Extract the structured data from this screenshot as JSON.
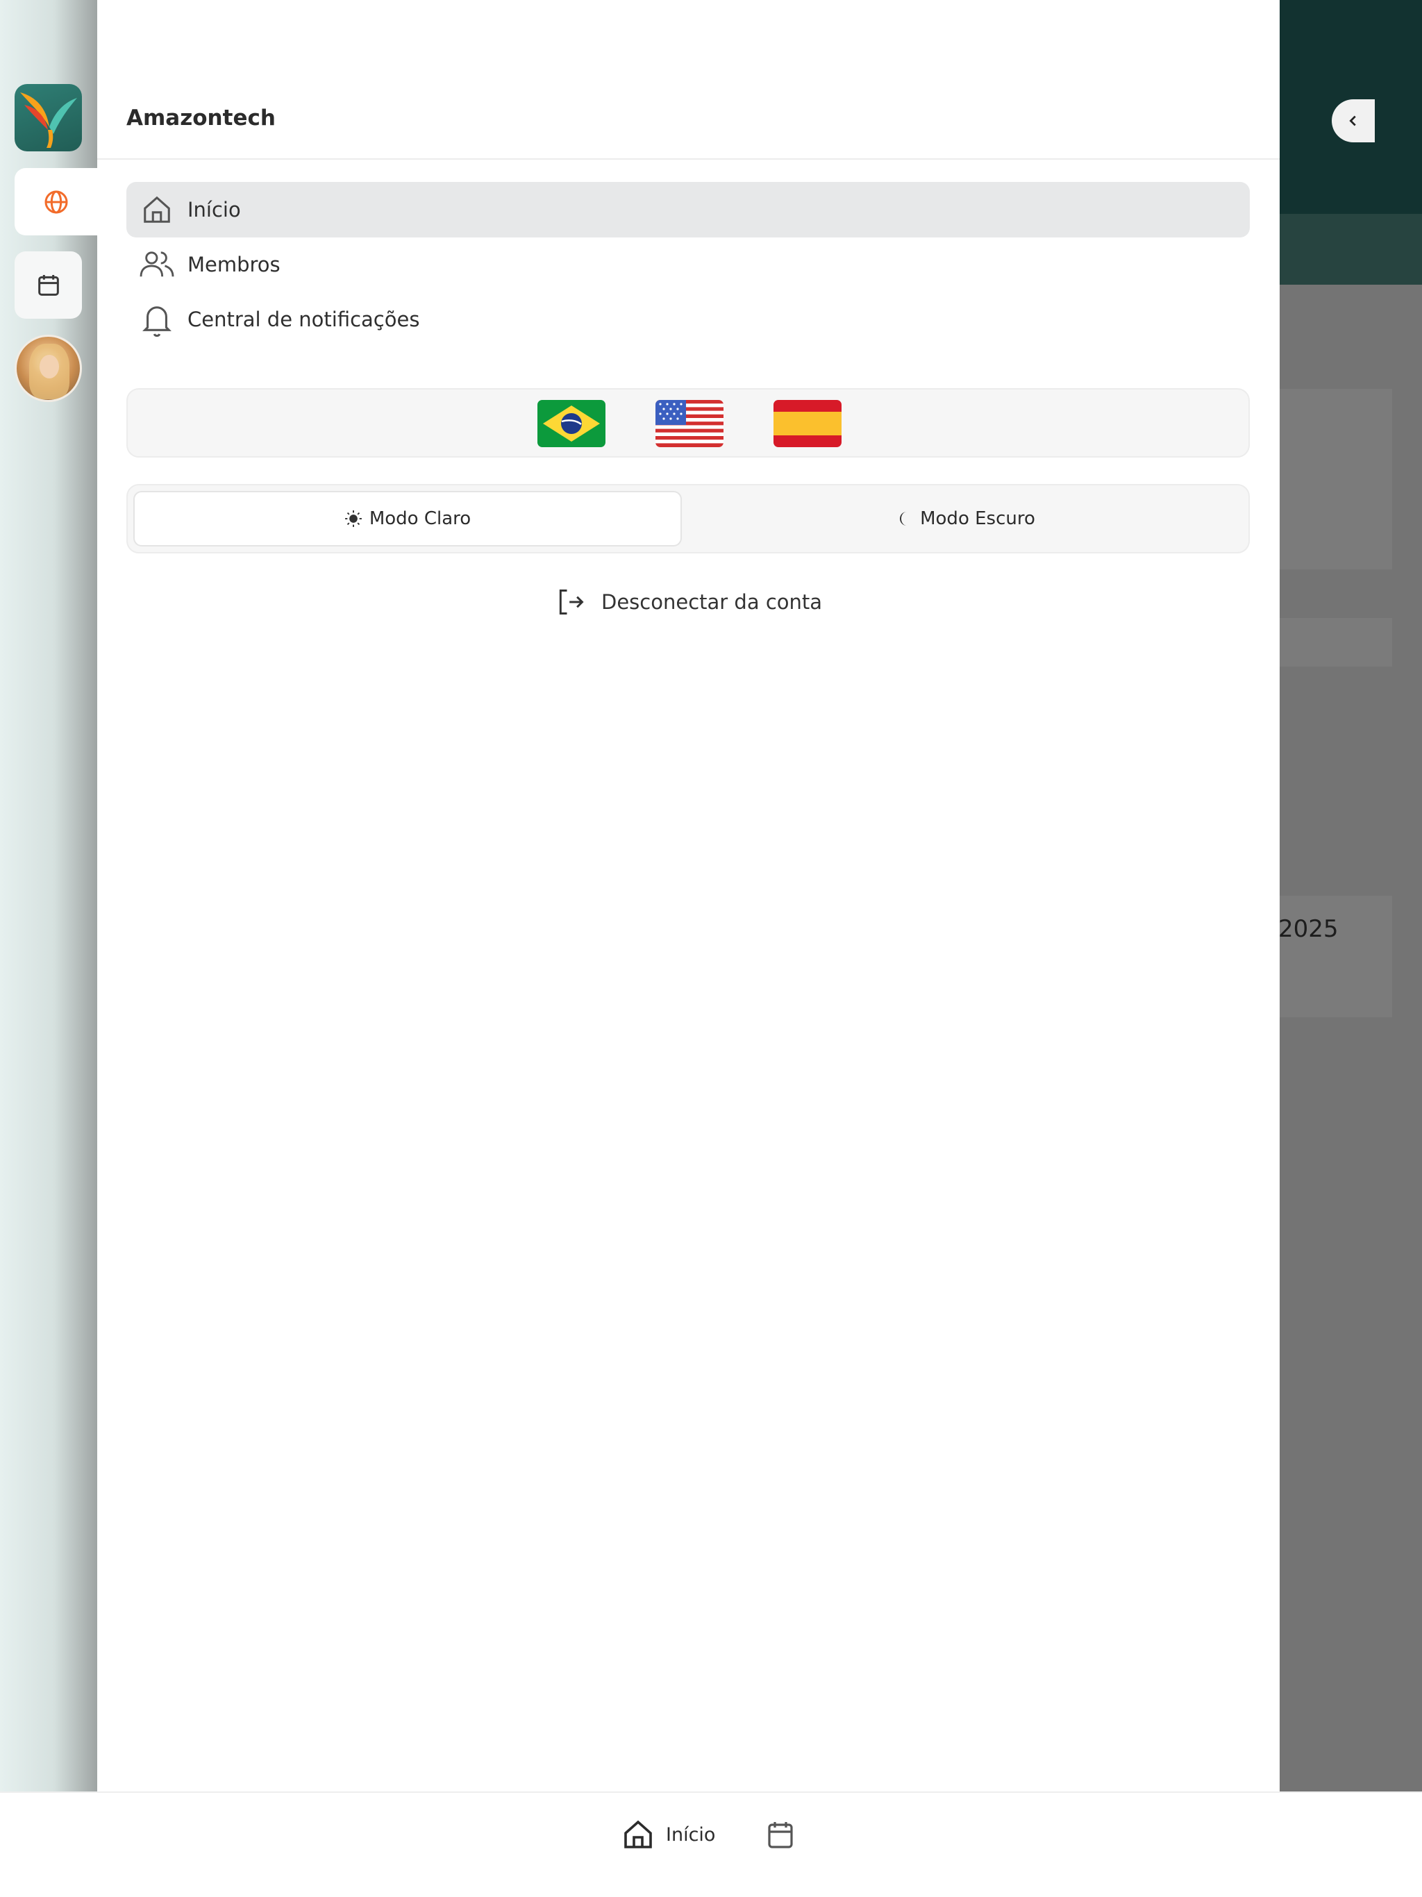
{
  "app": {
    "title": "Amazontech"
  },
  "background": {
    "partial_text": "2025"
  },
  "rail": {
    "items": [
      {
        "name": "app-logo",
        "icon": "bird-logo"
      },
      {
        "name": "globe",
        "icon": "globe-icon",
        "active": true
      },
      {
        "name": "calendar",
        "icon": "calendar-icon"
      },
      {
        "name": "avatar",
        "icon": "user-avatar"
      }
    ]
  },
  "drawer": {
    "nav": [
      {
        "label": "Início",
        "icon": "home-icon",
        "active": true
      },
      {
        "label": "Membros",
        "icon": "users-icon",
        "active": false
      },
      {
        "label": "Central de notificações",
        "icon": "bell-icon",
        "active": false
      }
    ],
    "languages": [
      {
        "code": "pt-BR",
        "icon": "brazil-flag-icon"
      },
      {
        "code": "en-US",
        "icon": "usa-flag-icon"
      },
      {
        "code": "es-ES",
        "icon": "spain-flag-icon"
      }
    ],
    "theme": {
      "light_label": "Modo Claro",
      "dark_label": "Modo Escuro",
      "selected": "light"
    },
    "logout_label": "Desconectar da conta"
  },
  "tabbar": {
    "home_label": "Início"
  },
  "colors": {
    "accent_orange": "#f26b2a",
    "rail_dark_green": "#123230",
    "active_nav_bg": "#e7e8e9"
  }
}
